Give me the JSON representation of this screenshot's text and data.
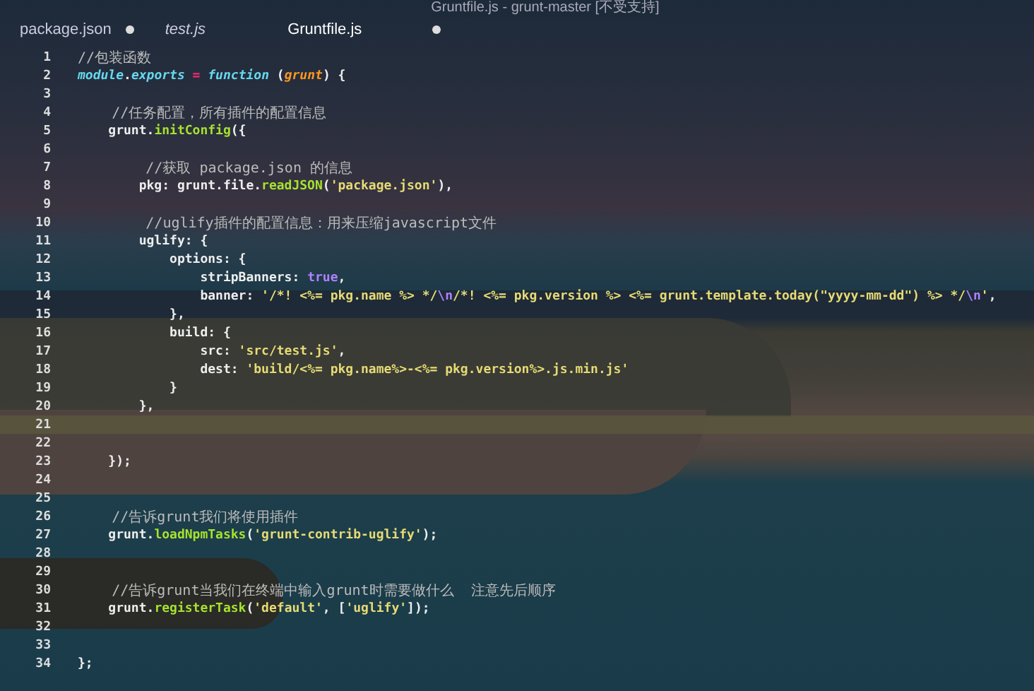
{
  "window": {
    "title": "Gruntfile.js - grunt-master [不受支持]"
  },
  "tabs": [
    {
      "label": "package.json",
      "selected": false,
      "modified": true,
      "preview": false
    },
    {
      "label": "test.js",
      "selected": false,
      "modified": false,
      "preview": true
    },
    {
      "label": "Gruntfile.js",
      "selected": true,
      "modified": true,
      "preview": false
    }
  ],
  "editor": {
    "lines": [
      {
        "number": "1",
        "current": false,
        "tokens": [
          {
            "kind": "comment",
            "text": "//包装函数"
          }
        ]
      },
      {
        "number": "2",
        "current": false,
        "tokens": [
          {
            "kind": "keyword",
            "text": "module"
          },
          {
            "kind": "plain",
            "text": "."
          },
          {
            "kind": "keyword",
            "text": "exports"
          },
          {
            "kind": "op",
            "text": " = "
          },
          {
            "kind": "keyword",
            "text": "function"
          },
          {
            "kind": "plain",
            "text": " ("
          },
          {
            "kind": "param",
            "text": "grunt"
          },
          {
            "kind": "plain",
            "text": ") {"
          }
        ]
      },
      {
        "number": "3",
        "current": false
      },
      {
        "number": "4",
        "current": false,
        "tokens": [
          {
            "kind": "comment",
            "text": "    //任务配置，所有插件的配置信息"
          }
        ]
      },
      {
        "number": "5",
        "current": false,
        "tokens": [
          {
            "kind": "plain",
            "text": "    grunt."
          },
          {
            "kind": "fn",
            "text": "initConfig"
          },
          {
            "kind": "plain",
            "text": "({"
          }
        ]
      },
      {
        "number": "6",
        "current": false
      },
      {
        "number": "7",
        "current": false,
        "tokens": [
          {
            "kind": "comment",
            "text": "        //获取 package.json 的信息"
          }
        ]
      },
      {
        "number": "8",
        "current": false,
        "tokens": [
          {
            "kind": "plain",
            "text": "        pkg: grunt.file."
          },
          {
            "kind": "fn",
            "text": "readJSON"
          },
          {
            "kind": "plain",
            "text": "("
          },
          {
            "kind": "string",
            "text": "'package.json'"
          },
          {
            "kind": "plain",
            "text": "),"
          }
        ]
      },
      {
        "number": "9",
        "current": false
      },
      {
        "number": "10",
        "current": false,
        "tokens": [
          {
            "kind": "comment",
            "text": "        //uglify插件的配置信息：用来压缩javascript文件"
          }
        ]
      },
      {
        "number": "11",
        "current": false,
        "tokens": [
          {
            "kind": "plain",
            "text": "        uglify: {"
          }
        ]
      },
      {
        "number": "12",
        "current": false,
        "tokens": [
          {
            "kind": "plain",
            "text": "            options: {"
          }
        ]
      },
      {
        "number": "13",
        "current": false,
        "tokens": [
          {
            "kind": "plain",
            "text": "                stripBanners: "
          },
          {
            "kind": "bool",
            "text": "true"
          },
          {
            "kind": "plain",
            "text": ","
          }
        ]
      },
      {
        "number": "14",
        "current": false,
        "tokens": [
          {
            "kind": "plain",
            "text": "                banner: "
          },
          {
            "kind": "string",
            "text": "'/*! <%= pkg.name %> */"
          },
          {
            "kind": "bool",
            "text": "\\n"
          },
          {
            "kind": "string",
            "text": "/*! <%= pkg.version %> <%= grunt.template.today(\"yyyy-mm-dd\") %> */"
          },
          {
            "kind": "bool",
            "text": "\\n"
          },
          {
            "kind": "string",
            "text": "'"
          },
          {
            "kind": "plain",
            "text": ","
          }
        ]
      },
      {
        "number": "15",
        "current": false,
        "tokens": [
          {
            "kind": "plain",
            "text": "            },"
          }
        ]
      },
      {
        "number": "16",
        "current": false,
        "tokens": [
          {
            "kind": "plain",
            "text": "            build: {"
          }
        ]
      },
      {
        "number": "17",
        "current": false,
        "tokens": [
          {
            "kind": "plain",
            "text": "                src: "
          },
          {
            "kind": "string",
            "text": "'src/test.js'"
          },
          {
            "kind": "plain",
            "text": ","
          }
        ]
      },
      {
        "number": "18",
        "current": false,
        "tokens": [
          {
            "kind": "plain",
            "text": "                dest: "
          },
          {
            "kind": "string",
            "text": "'build/<%= pkg.name%>-<%= pkg.version%>.js.min.js'"
          }
        ]
      },
      {
        "number": "19",
        "current": false,
        "tokens": [
          {
            "kind": "plain",
            "text": "            }"
          }
        ]
      },
      {
        "number": "20",
        "current": false,
        "tokens": [
          {
            "kind": "plain",
            "text": "        },"
          }
        ]
      },
      {
        "number": "21",
        "current": true
      },
      {
        "number": "22",
        "current": false
      },
      {
        "number": "23",
        "current": false,
        "tokens": [
          {
            "kind": "plain",
            "text": "    });"
          }
        ]
      },
      {
        "number": "24",
        "current": false
      },
      {
        "number": "25",
        "current": false
      },
      {
        "number": "26",
        "current": false,
        "tokens": [
          {
            "kind": "comment",
            "text": "    //告诉grunt我们将使用插件"
          }
        ]
      },
      {
        "number": "27",
        "current": false,
        "tokens": [
          {
            "kind": "plain",
            "text": "    grunt."
          },
          {
            "kind": "fn",
            "text": "loadNpmTasks"
          },
          {
            "kind": "plain",
            "text": "("
          },
          {
            "kind": "string",
            "text": "'grunt-contrib-uglify'"
          },
          {
            "kind": "plain",
            "text": ");"
          }
        ]
      },
      {
        "number": "28",
        "current": false
      },
      {
        "number": "29",
        "current": false
      },
      {
        "number": "30",
        "current": false,
        "tokens": [
          {
            "kind": "comment",
            "text": "    //告诉grunt当我们在终端中输入grunt时需要做什么  注意先后顺序"
          }
        ]
      },
      {
        "number": "31",
        "current": false,
        "tokens": [
          {
            "kind": "plain",
            "text": "    grunt."
          },
          {
            "kind": "fn",
            "text": "registerTask"
          },
          {
            "kind": "plain",
            "text": "("
          },
          {
            "kind": "string",
            "text": "'default'"
          },
          {
            "kind": "plain",
            "text": ", ["
          },
          {
            "kind": "string",
            "text": "'uglify'"
          },
          {
            "kind": "plain",
            "text": "]);"
          }
        ]
      },
      {
        "number": "32",
        "current": false
      },
      {
        "number": "33",
        "current": false
      },
      {
        "number": "34",
        "current": false,
        "tokens": [
          {
            "kind": "plain",
            "text": "};"
          }
        ]
      }
    ]
  }
}
